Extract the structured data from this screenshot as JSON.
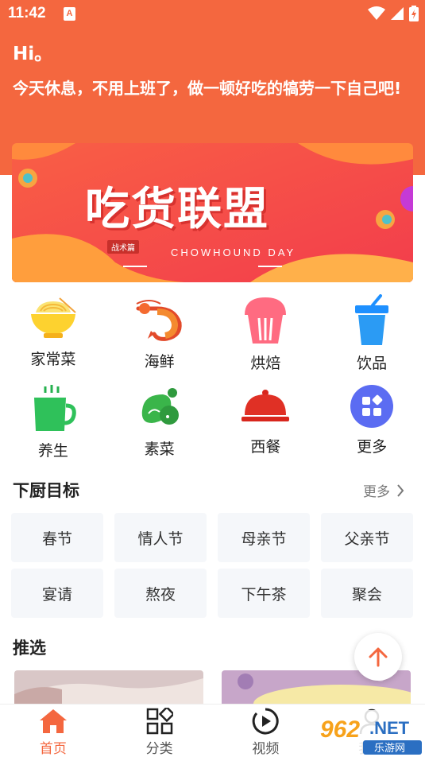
{
  "status_bar": {
    "time": "11:42",
    "notif": "A"
  },
  "header": {
    "greeting": "Hi。",
    "subtitle": "今天休息，不用上班了，做一顿好吃的犒劳一下自己吧!"
  },
  "banner": {
    "title": "吃货联盟",
    "tag": "战术篇",
    "subtitle": "CHOWHOUND DAY"
  },
  "categories": [
    {
      "label": "家常菜",
      "icon": "noodle-bowl-icon"
    },
    {
      "label": "海鲜",
      "icon": "shrimp-icon"
    },
    {
      "label": "烘焙",
      "icon": "cupcake-icon"
    },
    {
      "label": "饮品",
      "icon": "drink-cup-icon"
    },
    {
      "label": "养生",
      "icon": "tea-cup-icon"
    },
    {
      "label": "素菜",
      "icon": "vegetables-icon"
    },
    {
      "label": "西餐",
      "icon": "cloche-icon"
    },
    {
      "label": "更多",
      "icon": "more-apps-icon"
    }
  ],
  "goals": {
    "title": "下厨目标",
    "more": "更多",
    "tags": [
      "春节",
      "情人节",
      "母亲节",
      "父亲节",
      "宴请",
      "熬夜",
      "下午茶",
      "聚会"
    ]
  },
  "recommend": {
    "title": "推选"
  },
  "bottom_nav": [
    {
      "label": "首页",
      "icon": "home-icon",
      "active": true
    },
    {
      "label": "分类",
      "icon": "category-grid-icon",
      "active": false
    },
    {
      "label": "视频",
      "icon": "video-play-icon",
      "active": false
    },
    {
      "label": "我的",
      "icon": "profile-icon",
      "active": false
    }
  ],
  "watermark": {
    "text_top": "962",
    "text_net": ".NET",
    "text_bottom": "乐游网"
  },
  "colors": {
    "accent": "#f4673f",
    "tag_bg": "#f5f7fa"
  }
}
